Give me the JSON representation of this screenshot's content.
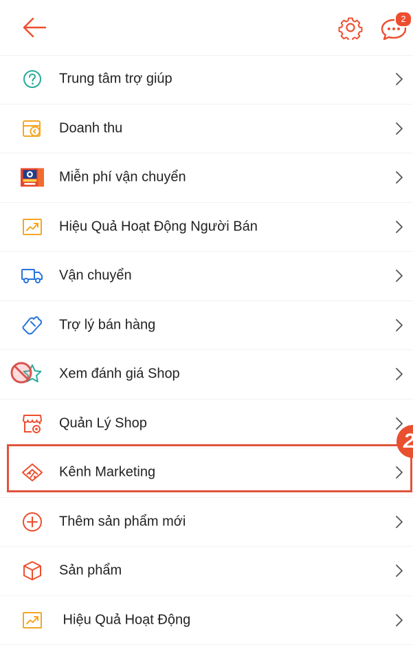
{
  "header": {
    "chat_badge_count": "2",
    "back_icon": "arrow-left-icon",
    "settings_icon": "gear-icon",
    "chat_icon": "chat-bubble-icon"
  },
  "colors": {
    "accent": "#ee4d2d",
    "highlight_border": "#e0533a"
  },
  "menu": {
    "items": [
      {
        "label": "Trung tâm trợ giúp",
        "icon": "help-circle-icon"
      },
      {
        "label": "Doanh thu",
        "icon": "revenue-wallet-icon"
      },
      {
        "label": "Miễn phí vận chuyển",
        "icon": "free-shipping-banner-icon"
      },
      {
        "label": "Hiệu Quả Hoạt Động Người Bán",
        "icon": "performance-chart-icon"
      },
      {
        "label": "Vận chuyển",
        "icon": "truck-icon"
      },
      {
        "label": "Trợ lý bán hàng",
        "icon": "sales-assistant-hand-icon"
      },
      {
        "label": "Xem đánh giá Shop",
        "icon": "star-icon"
      },
      {
        "label": "Quản Lý Shop",
        "icon": "shop-settings-icon"
      },
      {
        "label": "Kênh Marketing",
        "icon": "marketing-tag-icon"
      },
      {
        "label": "Thêm sản phẩm mới",
        "icon": "add-circle-icon"
      },
      {
        "label": "Sản phẩm",
        "icon": "product-box-icon"
      },
      {
        "label": " Hiệu Quả Hoạt Động",
        "icon": "performance-chart-icon"
      }
    ]
  },
  "annotation": {
    "step_number": "2",
    "highlighted_item": "Kênh Marketing"
  }
}
